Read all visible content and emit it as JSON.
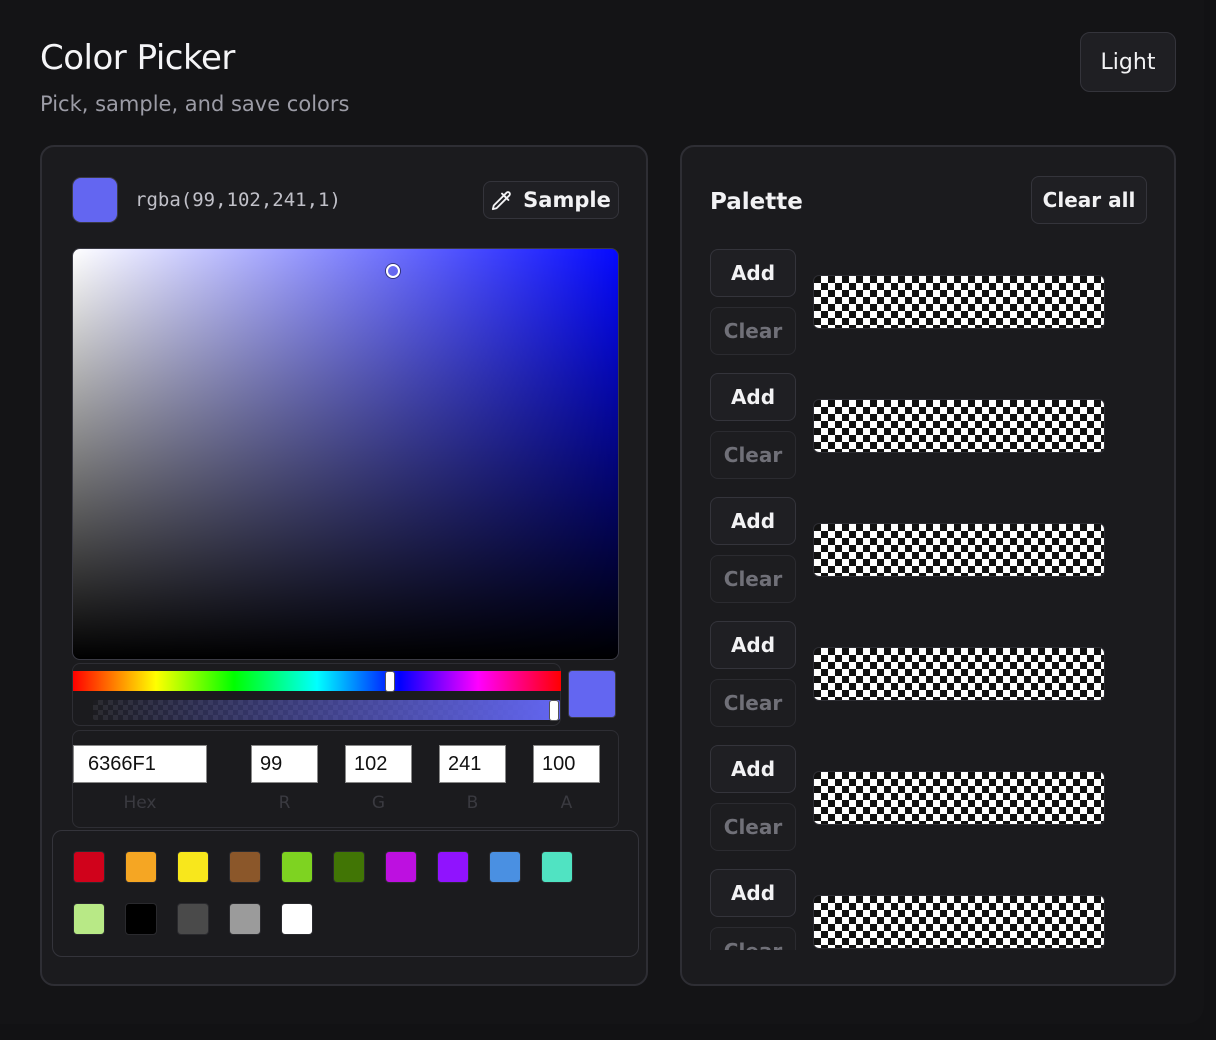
{
  "header": {
    "title": "Color Picker",
    "subtitle": "Pick, sample, and save colors",
    "theme_button": "Light"
  },
  "picker": {
    "current_color": "#6366F1",
    "rgba_text": "rgba(99,102,241,1)",
    "sample_button": "Sample",
    "hue_fraction": 0.65,
    "alpha_fraction": 1.0,
    "fields": {
      "hex": {
        "value": "6366F1",
        "label": "Hex"
      },
      "r": {
        "value": "99",
        "label": "R"
      },
      "g": {
        "value": "102",
        "label": "G"
      },
      "b": {
        "value": "241",
        "label": "B"
      },
      "a": {
        "value": "100",
        "label": "A"
      }
    }
  },
  "presets": [
    "#D0021B",
    "#F5A623",
    "#F8E71C",
    "#8B572A",
    "#7ED321",
    "#417505",
    "#BD10E0",
    "#9013FE",
    "#4A90E2",
    "#50E3C2",
    "#B8E986",
    "#000000",
    "#4A4A4A",
    "#9B9B9B",
    "#FFFFFF"
  ],
  "palette": {
    "title": "Palette",
    "clear_all_button": "Clear all",
    "rows": [
      {
        "add": "Add",
        "clear": "Clear"
      },
      {
        "add": "Add",
        "clear": "Clear"
      },
      {
        "add": "Add",
        "clear": "Clear"
      },
      {
        "add": "Add",
        "clear": "Clear"
      },
      {
        "add": "Add",
        "clear": "Clear"
      },
      {
        "add": "Add",
        "clear": "Clear"
      }
    ]
  }
}
